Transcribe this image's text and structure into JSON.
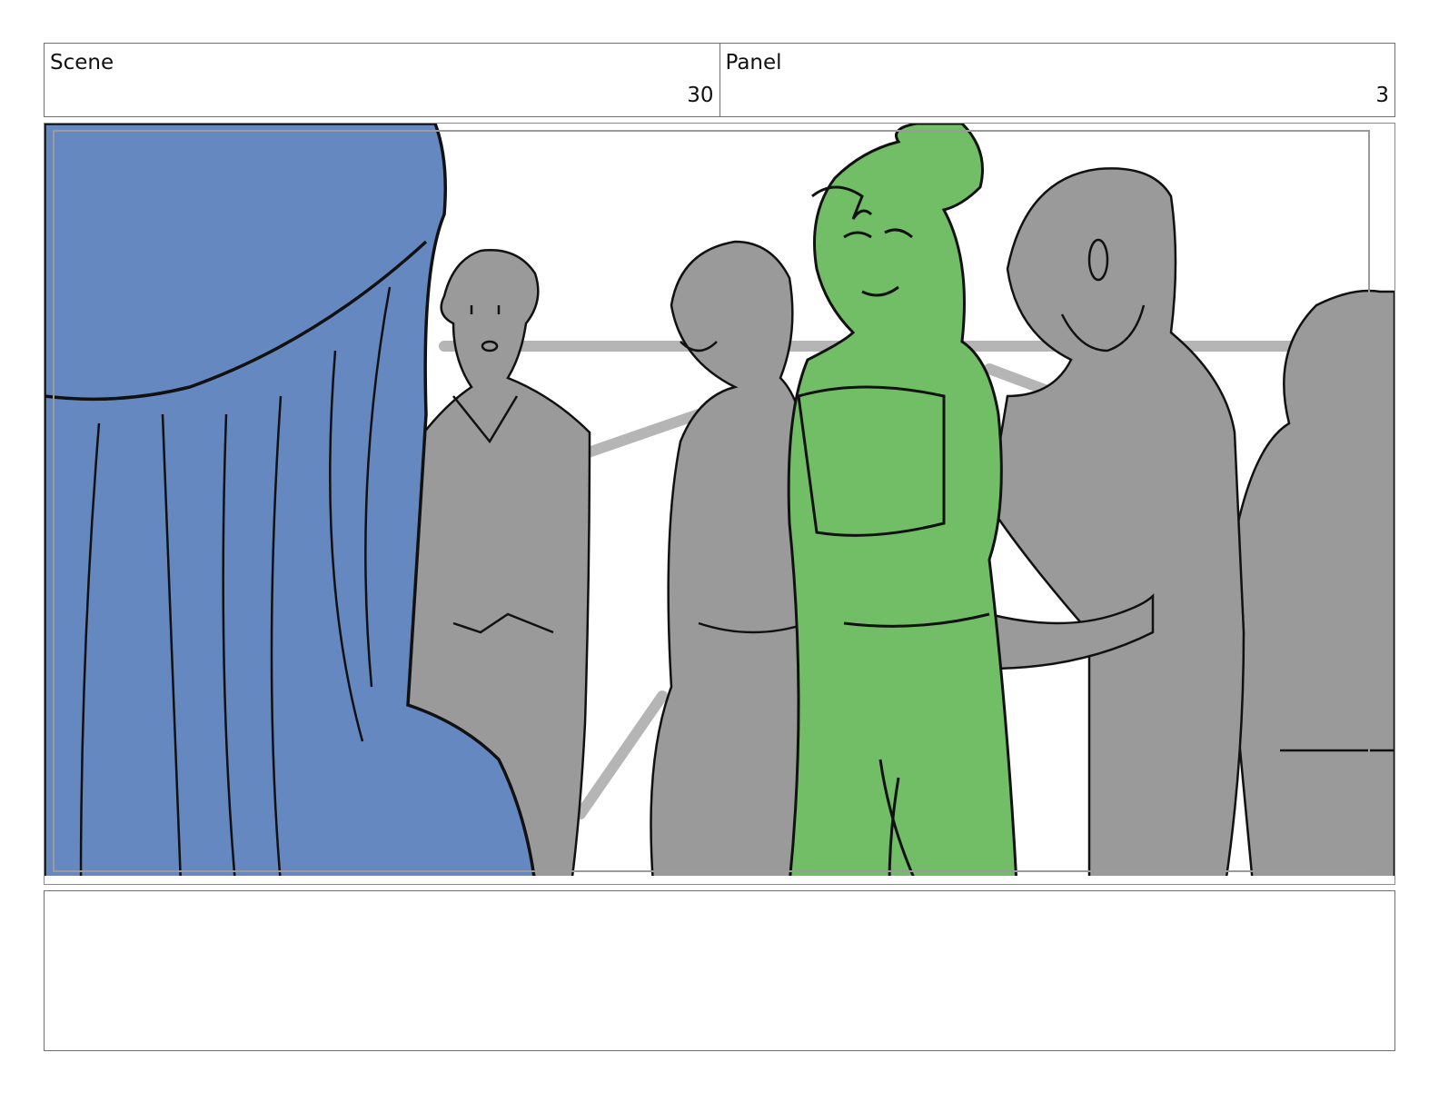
{
  "header": {
    "scene_label": "Scene",
    "scene_number": "30",
    "panel_label": "Panel",
    "panel_number": "3"
  },
  "artwork": {
    "description_icon": "storyboard-sketch",
    "colors": {
      "foreground_figure": "#6688C0",
      "focus_figure": "#72BE66",
      "background_crowd": "#9A9A9A",
      "line": "#111111",
      "backdrop_lines": "#B5B5B5"
    }
  },
  "notes": {
    "text": ""
  }
}
